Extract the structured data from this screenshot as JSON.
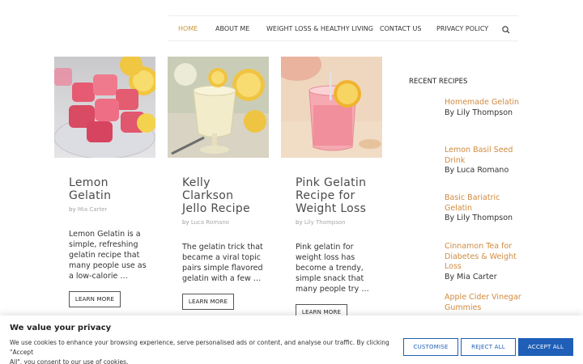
{
  "nav": {
    "items": [
      "HOME",
      "ABOUT ME",
      "WEIGHT LOSS & HEALTHY LIVING",
      "CONTACT US",
      "PRIVACY POLICY"
    ],
    "search_icon": "search-icon",
    "active_color": "#c9973a"
  },
  "cards": [
    {
      "title_lines": [
        "Lemon",
        "Gelatin"
      ],
      "by": "by",
      "author": "Mia Carter",
      "excerpt_lines": [
        "Lemon Gelatin is a",
        "simple, refreshing",
        "gelatin recipe that",
        "many people use as",
        "a low-calorie …"
      ],
      "button": "LEARN MORE"
    },
    {
      "title_lines": [
        "Kelly",
        "Clarkson",
        "Jello Recipe"
      ],
      "by": "by",
      "author": "Luca Romano",
      "excerpt_lines": [
        "The gelatin trick that",
        "became a viral topic",
        "pairs simple flavored",
        "gelatin with a few …"
      ],
      "button": "LEARN MORE"
    },
    {
      "title_lines": [
        "Pink Gelatin",
        "Recipe for",
        "Weight Loss"
      ],
      "by": "by",
      "author": "Lily Thompson",
      "excerpt_lines": [
        "Pink gelatin for",
        "weight loss has",
        "become a trendy,",
        "simple snack that",
        "many people try …"
      ],
      "button": "LEARN MORE"
    }
  ],
  "sidebar": {
    "heading": "RECENT RECIPES",
    "link_color": "#d08a3e",
    "items": [
      {
        "title_lines": [
          "Homemade Gelatin"
        ],
        "author": "By Lily Thompson"
      },
      {
        "title_lines": [
          "Lemon Basil Seed",
          "Drink"
        ],
        "author": "By Luca Romano"
      },
      {
        "title_lines": [
          "Basic Bariatric",
          "Gelatin"
        ],
        "author": "By Lily Thompson"
      },
      {
        "title_lines": [
          "Cinnamon Tea for",
          "Diabetes & Weight",
          "Loss"
        ],
        "author": "By Mia Carter"
      },
      {
        "title_lines": [
          "Apple Cider Vinegar",
          "Gummies"
        ],
        "author": ""
      }
    ]
  },
  "cookie": {
    "title": "We value your privacy",
    "text_lines": [
      "We use cookies to enhance your browsing experience, serve personalised ads or content, and analyse our traffic. By clicking \"Accept",
      "All\", you consent to our use of cookies."
    ],
    "customise": "CUSTOMISE",
    "reject": "REJECT ALL",
    "accept": "ACCEPT ALL",
    "accent_color": "#1f5fb8"
  }
}
